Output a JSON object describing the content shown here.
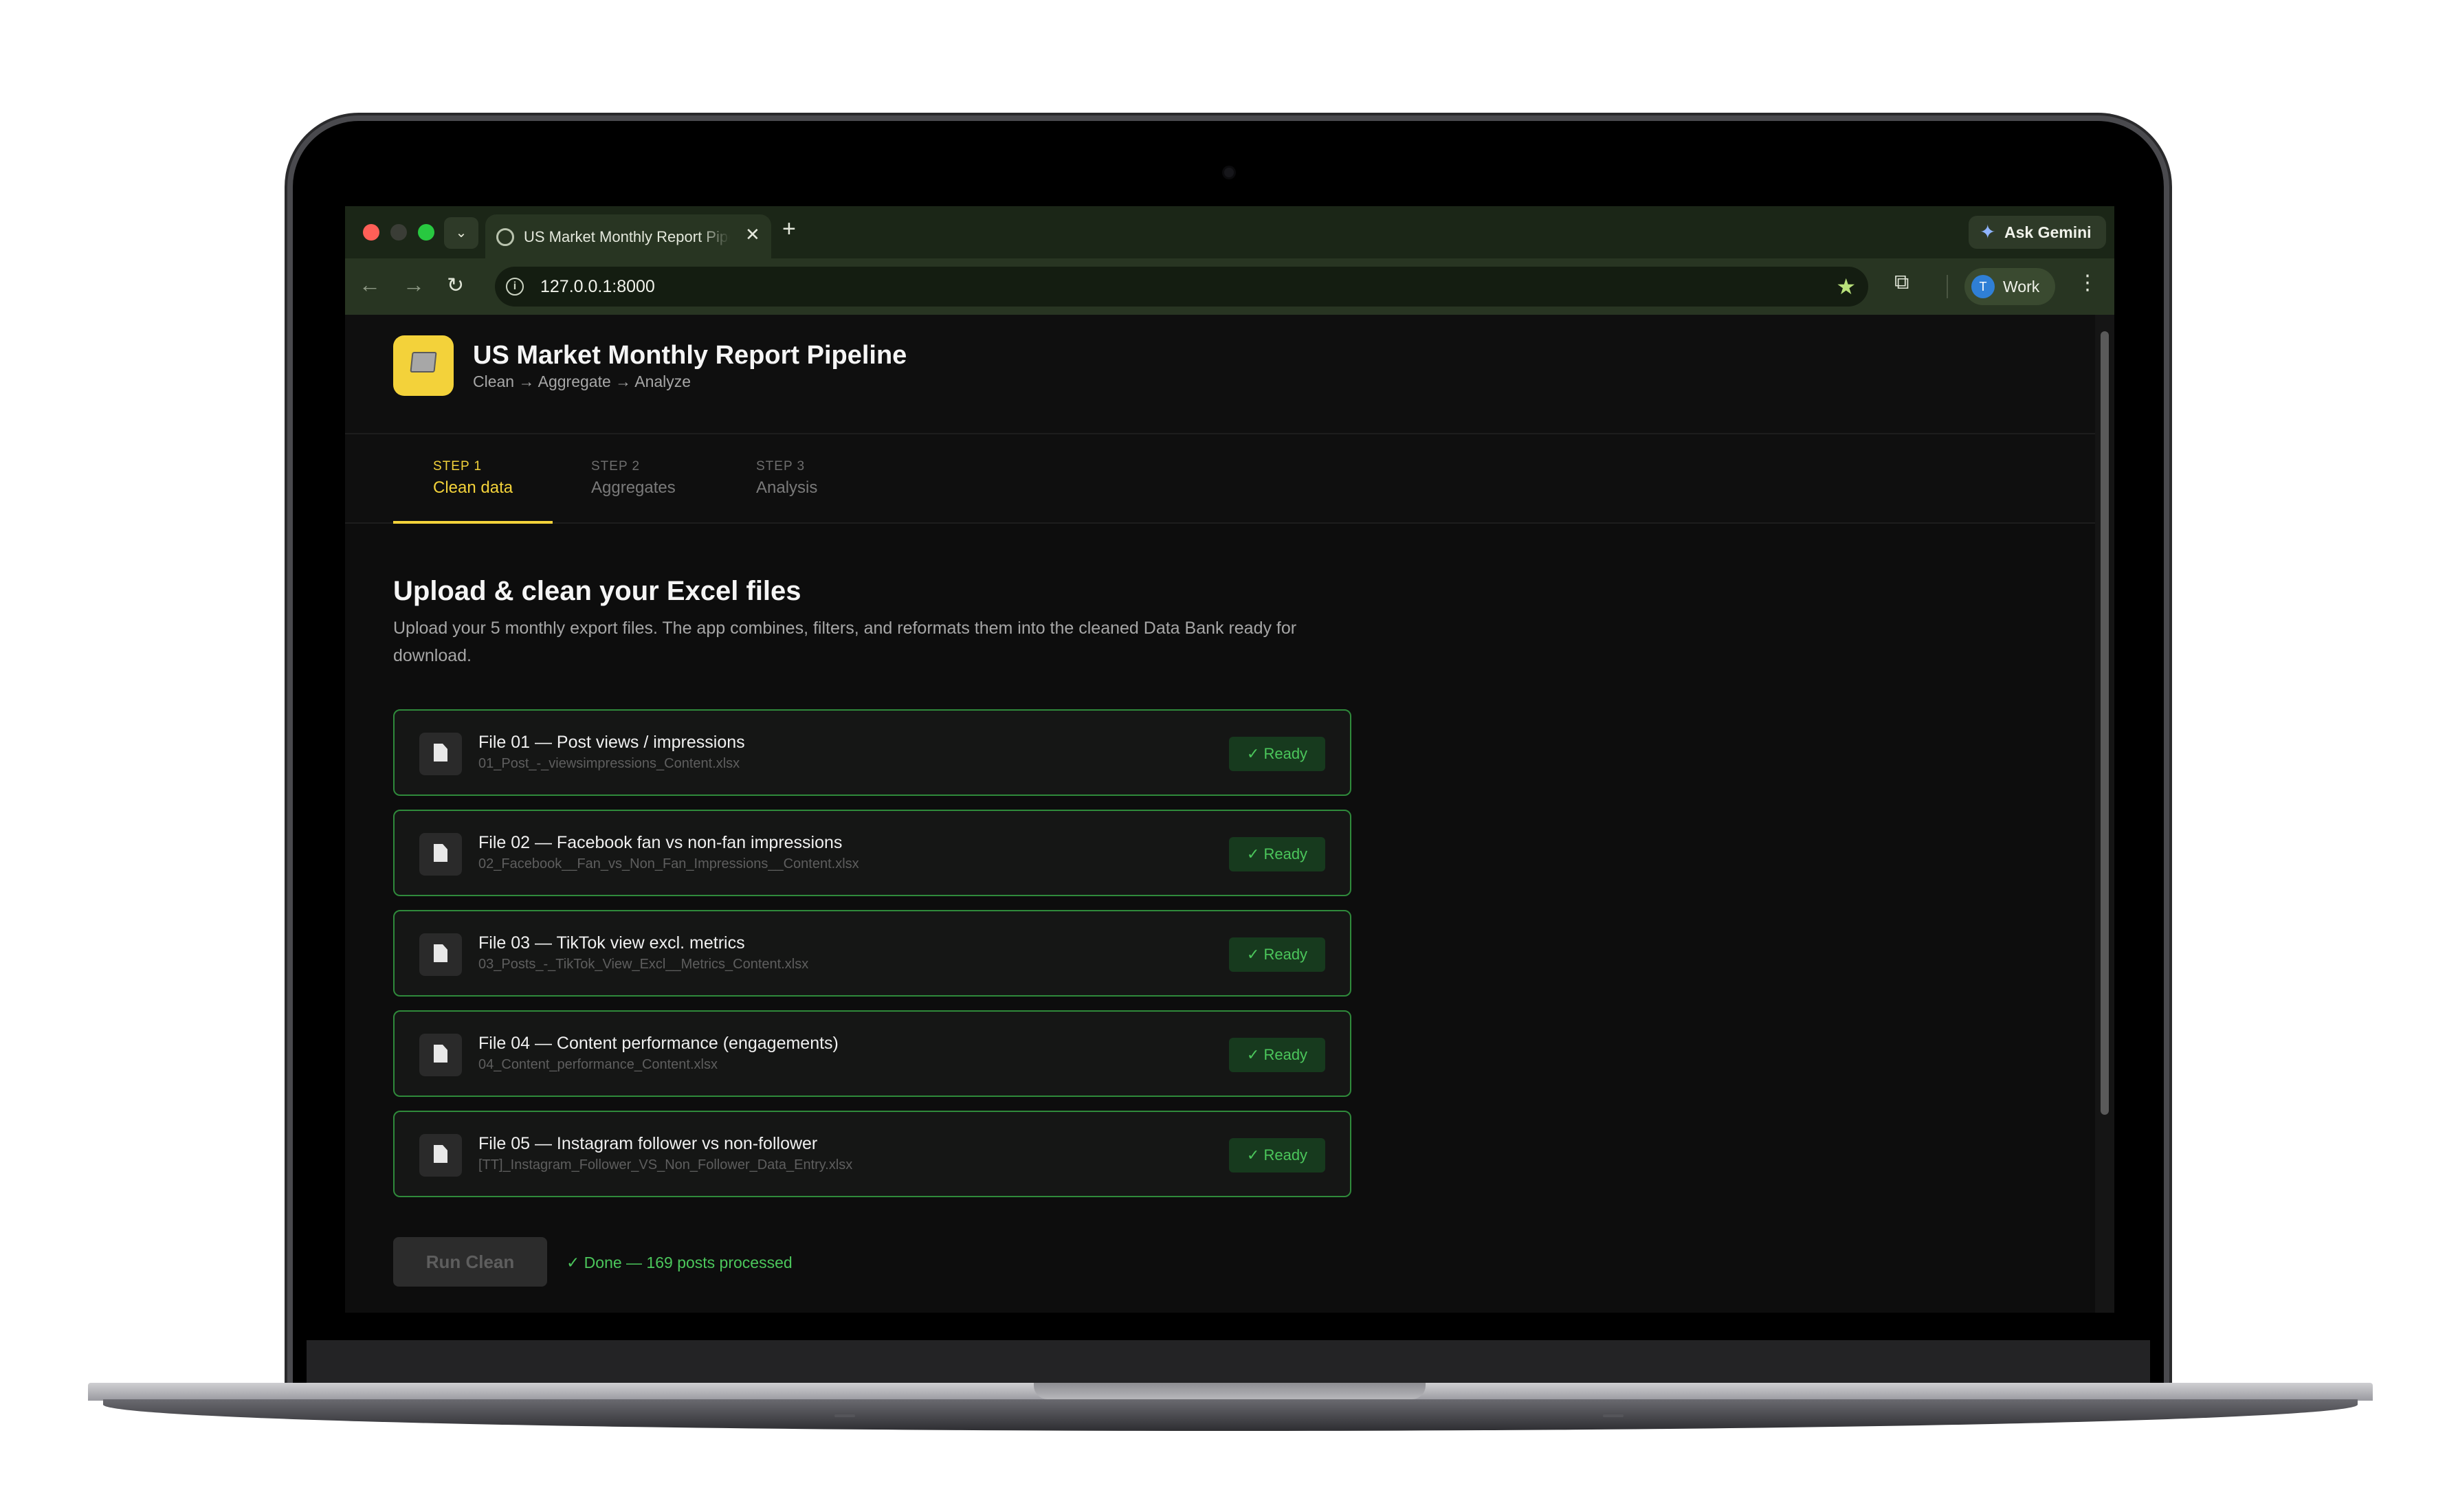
{
  "browser": {
    "tab_title": "US Market Monthly Report Pipeline",
    "tab_close_glyph": "✕",
    "new_tab_glyph": "+",
    "tab_menu_glyph": "⌄",
    "gemini_label": "Ask Gemini",
    "url": "127.0.0.1:8000",
    "profile_initial": "T",
    "profile_label": "Work",
    "icons": [
      "back-icon",
      "forward-icon",
      "reload-icon",
      "info-icon",
      "star-icon",
      "extensions-icon",
      "more-icon",
      "gemini-icon"
    ]
  },
  "app": {
    "title": "US Market Monthly Report Pipeline",
    "subtitle": "Clean → Aggregate → Analyze",
    "accent_color": "#f3d23a"
  },
  "steps": [
    {
      "num": "STEP 1",
      "label": "Clean data",
      "active": true
    },
    {
      "num": "STEP 2",
      "label": "Aggregates",
      "active": false
    },
    {
      "num": "STEP 3",
      "label": "Analysis",
      "active": false
    }
  ],
  "section": {
    "title": "Upload & clean your Excel files",
    "description": "Upload your 5 monthly export files. The app combines, filters, and reformats them into the cleaned Data Bank ready for download."
  },
  "files": [
    {
      "title": "File 01 — Post views / impressions",
      "filename": "01_Post_-_viewsimpressions_Content.xlsx",
      "status": "✓ Ready"
    },
    {
      "title": "File 02 — Facebook fan vs non-fan impressions",
      "filename": "02_Facebook__Fan_vs_Non_Fan_Impressions__Content.xlsx",
      "status": "✓ Ready"
    },
    {
      "title": "File 03 — TikTok view excl. metrics",
      "filename": "03_Posts_-_TikTok_View_Excl__Metrics_Content.xlsx",
      "status": "✓ Ready"
    },
    {
      "title": "File 04 — Content performance (engagements)",
      "filename": "04_Content_performance_Content.xlsx",
      "status": "✓ Ready"
    },
    {
      "title": "File 05 — Instagram follower vs non-follower",
      "filename": "[TT]_Instagram_Follower_VS_Non_Follower_Data_Entry.xlsx",
      "status": "✓ Ready"
    }
  ],
  "actions": {
    "run_label": "Run Clean",
    "status_text": "✓ Done — 169 posts processed",
    "status_color": "#4bc65b"
  }
}
